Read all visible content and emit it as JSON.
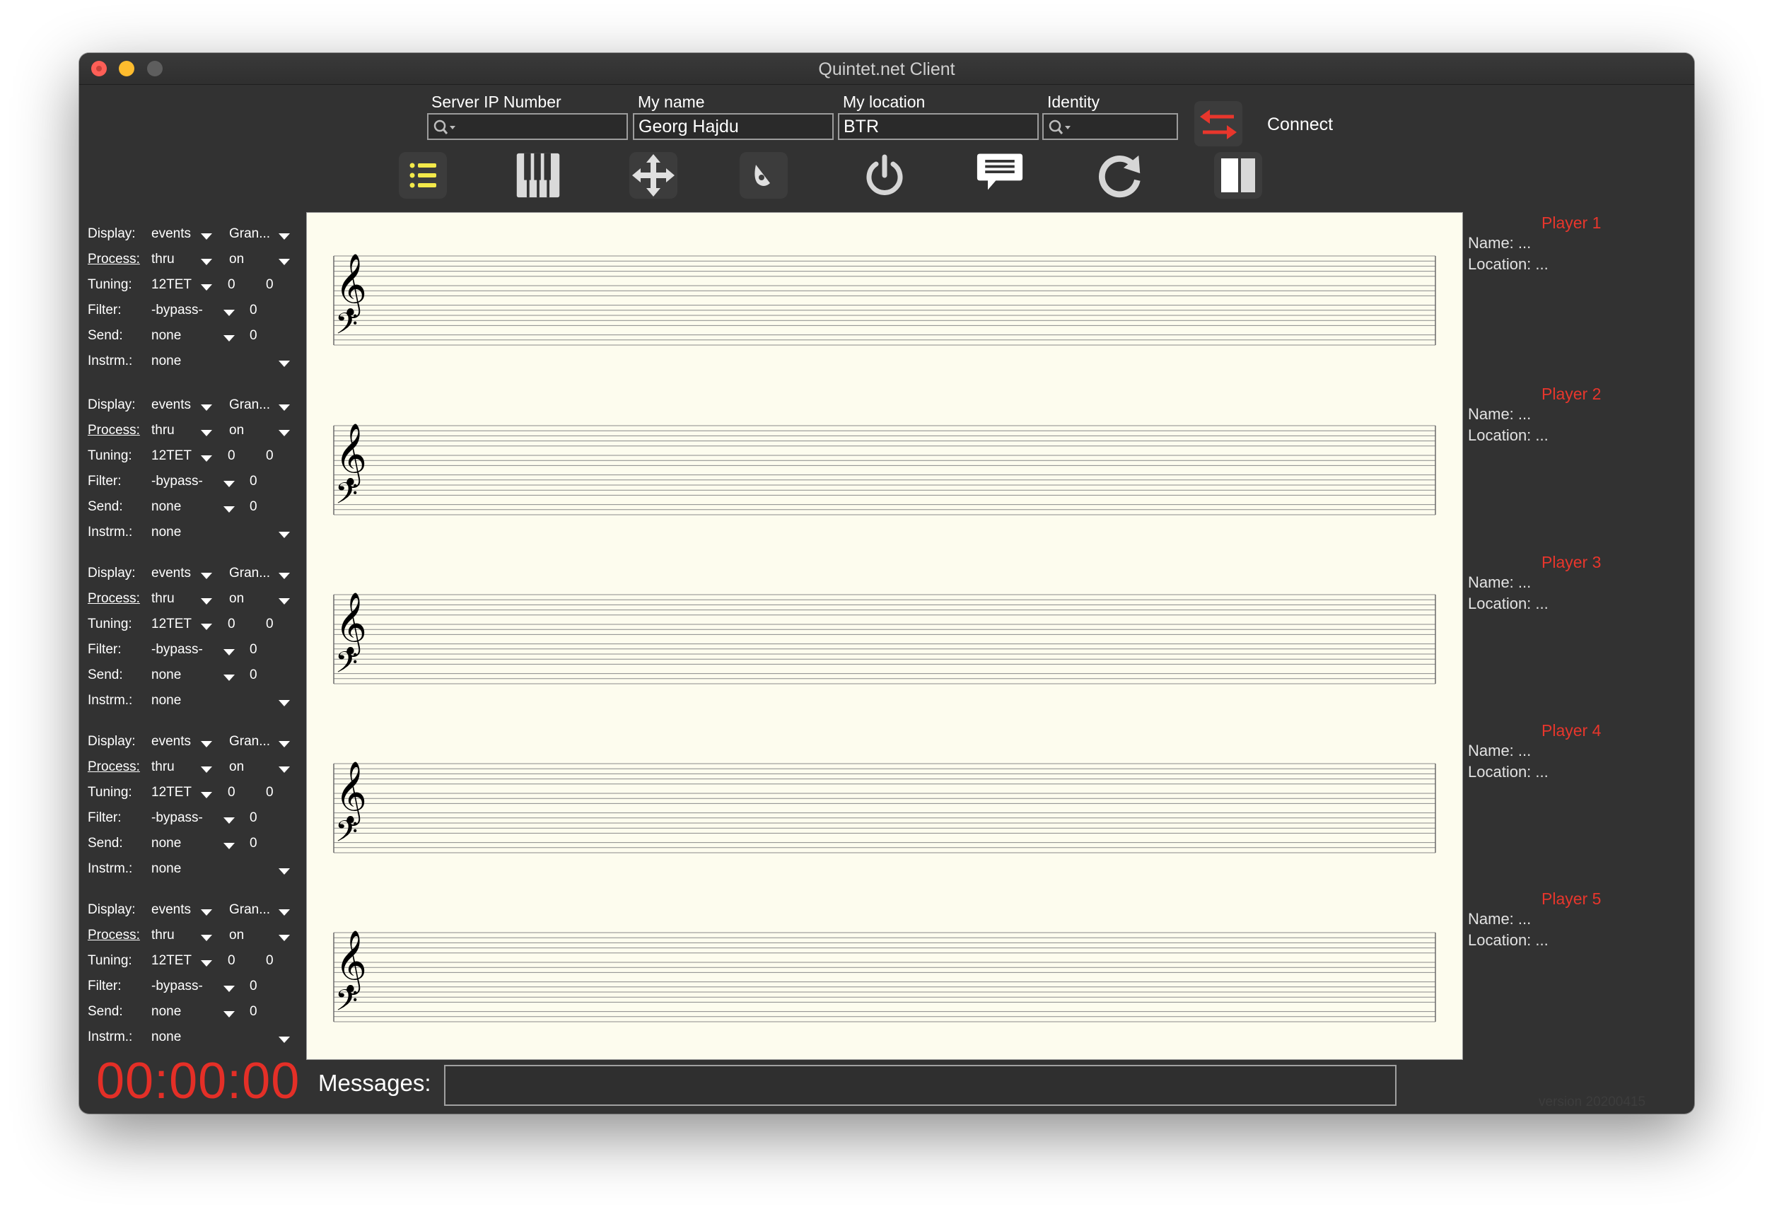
{
  "window": {
    "title": "Quintet.net Client"
  },
  "header": {
    "server_ip_label": "Server IP Number",
    "server_ip_value": "",
    "my_name_label": "My name",
    "my_name_value": "Georg Hajdu",
    "my_location_label": "My location",
    "my_location_value": "BTR",
    "identity_label": "Identity",
    "identity_value": "",
    "connect_label": "Connect"
  },
  "toolbar": {
    "icons": [
      "list-icon",
      "piano-keys-icon",
      "move-arrows-icon",
      "speaker-icon",
      "power-icon",
      "chat-bubble-icon",
      "refresh-icon",
      "split-view-icon"
    ]
  },
  "controls": {
    "display_label": "Display:",
    "process_label": "Process:",
    "tuning_label": "Tuning:",
    "filter_label": "Filter:",
    "send_label": "Send:",
    "instrm_label": "Instrm.:",
    "groups": [
      {
        "display": "events",
        "gran": "Gran...",
        "process": "thru",
        "process_state": "on",
        "tuning": "12TET",
        "tuning_a": "0",
        "tuning_b": "0",
        "filter": "-bypass-",
        "filter_val": "0",
        "send": "none",
        "send_val": "0",
        "instrm": "none"
      },
      {
        "display": "events",
        "gran": "Gran...",
        "process": "thru",
        "process_state": "on",
        "tuning": "12TET",
        "tuning_a": "0",
        "tuning_b": "0",
        "filter": "-bypass-",
        "filter_val": "0",
        "send": "none",
        "send_val": "0",
        "instrm": "none"
      },
      {
        "display": "events",
        "gran": "Gran...",
        "process": "thru",
        "process_state": "on",
        "tuning": "12TET",
        "tuning_a": "0",
        "tuning_b": "0",
        "filter": "-bypass-",
        "filter_val": "0",
        "send": "none",
        "send_val": "0",
        "instrm": "none"
      },
      {
        "display": "events",
        "gran": "Gran...",
        "process": "thru",
        "process_state": "on",
        "tuning": "12TET",
        "tuning_a": "0",
        "tuning_b": "0",
        "filter": "-bypass-",
        "filter_val": "0",
        "send": "none",
        "send_val": "0",
        "instrm": "none"
      },
      {
        "display": "events",
        "gran": "Gran...",
        "process": "thru",
        "process_state": "on",
        "tuning": "12TET",
        "tuning_a": "0",
        "tuning_b": "0",
        "filter": "-bypass-",
        "filter_val": "0",
        "send": "none",
        "send_val": "0",
        "instrm": "none"
      }
    ]
  },
  "score": {
    "systems": 5,
    "treble_clef": "𝄞",
    "bass_clef": "𝄢"
  },
  "players": [
    {
      "title": "Player 1",
      "name": "Name: ...",
      "location": "Location: ..."
    },
    {
      "title": "Player 2",
      "name": "Name: ...",
      "location": "Location: ..."
    },
    {
      "title": "Player 3",
      "name": "Name: ...",
      "location": "Location: ..."
    },
    {
      "title": "Player 4",
      "name": "Name: ...",
      "location": "Location: ..."
    },
    {
      "title": "Player 5",
      "name": "Name: ...",
      "location": "Location: ..."
    }
  ],
  "footer": {
    "clock": "00:00:00",
    "messages_label": "Messages:",
    "messages_value": "",
    "version": "version 20200415"
  },
  "colors": {
    "window_bg": "#323232",
    "accent_red": "#e8362c",
    "clock_red": "#e42f27",
    "list_icon_yellow": "#f3e94a",
    "paper": "#fdfcee"
  }
}
